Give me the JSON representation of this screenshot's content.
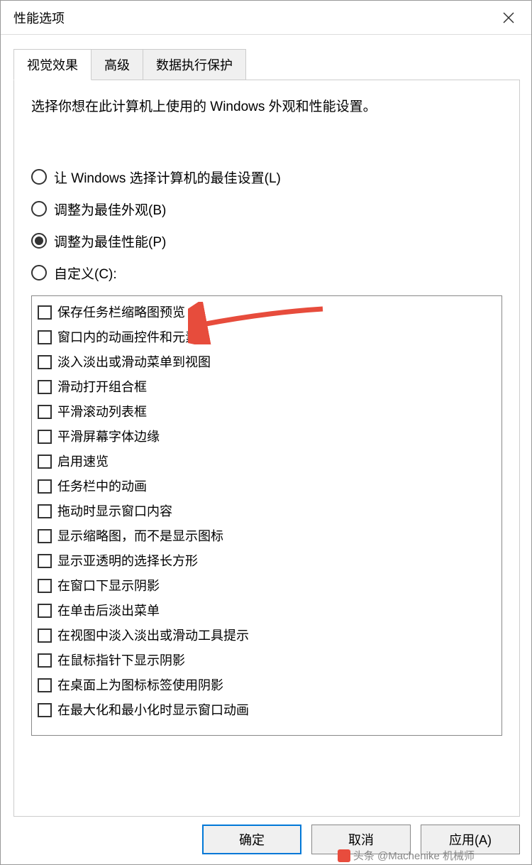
{
  "window": {
    "title": "性能选项"
  },
  "tabs": [
    {
      "label": "视觉效果",
      "active": true
    },
    {
      "label": "高级",
      "active": false
    },
    {
      "label": "数据执行保护",
      "active": false
    }
  ],
  "instruction": "选择你想在此计算机上使用的 Windows 外观和性能设置。",
  "radios": [
    {
      "label": "让 Windows 选择计算机的最佳设置(L)",
      "checked": false
    },
    {
      "label": "调整为最佳外观(B)",
      "checked": false
    },
    {
      "label": "调整为最佳性能(P)",
      "checked": true
    },
    {
      "label": "自定义(C):",
      "checked": false
    }
  ],
  "checkboxes": [
    {
      "label": "保存任务栏缩略图预览",
      "checked": false
    },
    {
      "label": "窗口内的动画控件和元素",
      "checked": false
    },
    {
      "label": "淡入淡出或滑动菜单到视图",
      "checked": false
    },
    {
      "label": "滑动打开组合框",
      "checked": false
    },
    {
      "label": "平滑滚动列表框",
      "checked": false
    },
    {
      "label": "平滑屏幕字体边缘",
      "checked": false
    },
    {
      "label": "启用速览",
      "checked": false
    },
    {
      "label": "任务栏中的动画",
      "checked": false
    },
    {
      "label": "拖动时显示窗口内容",
      "checked": false
    },
    {
      "label": "显示缩略图，而不是显示图标",
      "checked": false
    },
    {
      "label": "显示亚透明的选择长方形",
      "checked": false
    },
    {
      "label": "在窗口下显示阴影",
      "checked": false
    },
    {
      "label": "在单击后淡出菜单",
      "checked": false
    },
    {
      "label": "在视图中淡入淡出或滑动工具提示",
      "checked": false
    },
    {
      "label": "在鼠标指针下显示阴影",
      "checked": false
    },
    {
      "label": "在桌面上为图标标签使用阴影",
      "checked": false
    },
    {
      "label": "在最大化和最小化时显示窗口动画",
      "checked": false
    }
  ],
  "buttons": {
    "ok": "确定",
    "cancel": "取消",
    "apply": "应用(A)"
  },
  "watermark": "头条 @Machenike 机械师"
}
